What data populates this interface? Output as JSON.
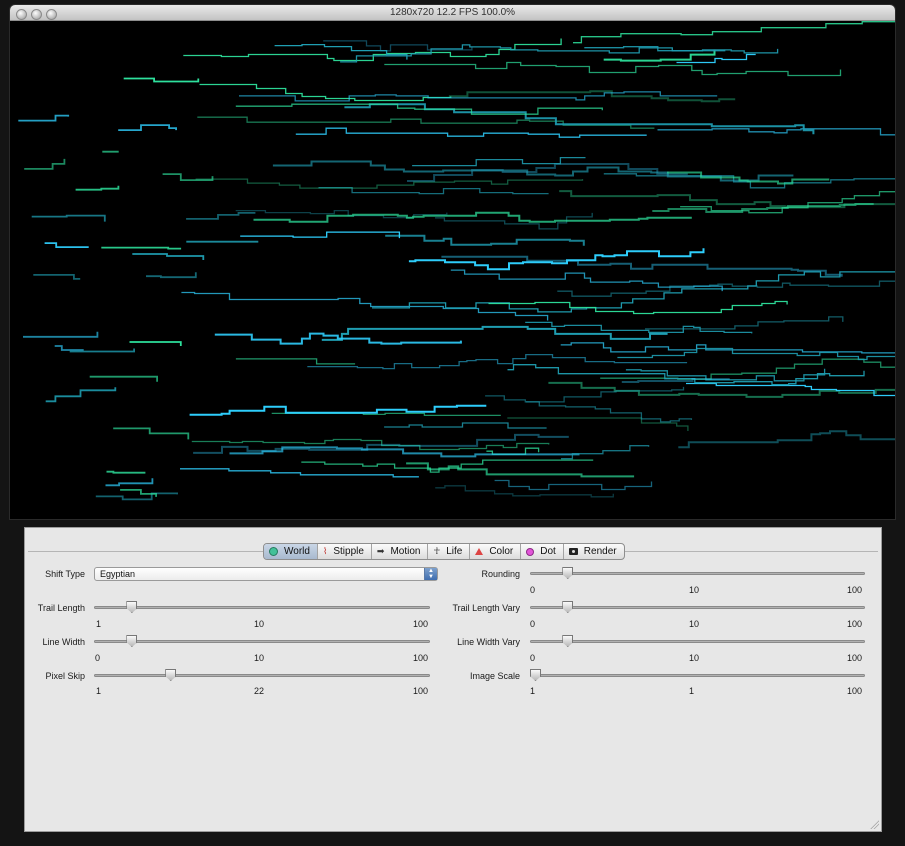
{
  "window": {
    "title": "1280x720 12.2 FPS 100.0%"
  },
  "tabs": [
    {
      "label": "World",
      "icon": "world-icon",
      "active": true
    },
    {
      "label": "Stipple",
      "icon": "stipple-icon",
      "active": false
    },
    {
      "label": "Motion",
      "icon": "motion-icon",
      "active": false
    },
    {
      "label": "Life",
      "icon": "life-icon",
      "active": false
    },
    {
      "label": "Color",
      "icon": "color-icon",
      "active": false
    },
    {
      "label": "Dot",
      "icon": "dot-icon",
      "active": false
    },
    {
      "label": "Render",
      "icon": "camera-icon",
      "active": false
    }
  ],
  "controls": {
    "shift_type": {
      "label": "Shift Type",
      "value": "Egyptian"
    },
    "trail_length": {
      "label": "Trail Length",
      "min": "1",
      "value": "10",
      "max": "100",
      "level": 10
    },
    "line_width": {
      "label": "Line Width",
      "min": "0",
      "value": "10",
      "max": "100",
      "level": 10
    },
    "pixel_skip": {
      "label": "Pixel Skip",
      "min": "1",
      "value": "22",
      "max": "100",
      "level": 22
    },
    "rounding": {
      "label": "Rounding",
      "min": "0",
      "value": "10",
      "max": "100",
      "level": 10
    },
    "trail_length_vary": {
      "label": "Trail Length Vary",
      "min": "0",
      "value": "10",
      "max": "100",
      "level": 10
    },
    "line_width_vary": {
      "label": "Line Width Vary",
      "min": "0",
      "value": "10",
      "max": "100",
      "level": 10
    },
    "image_scale": {
      "label": "Image Scale",
      "min": "1",
      "value": "1",
      "max": "100",
      "level": 0
    }
  },
  "colors": {
    "trail_cyan": "#2fd0ff",
    "trail_teal": "#1f9fb3",
    "trail_green": "#2ee39e",
    "canvas_bg": "#000000",
    "panel_bg": "#e7e7e7"
  }
}
